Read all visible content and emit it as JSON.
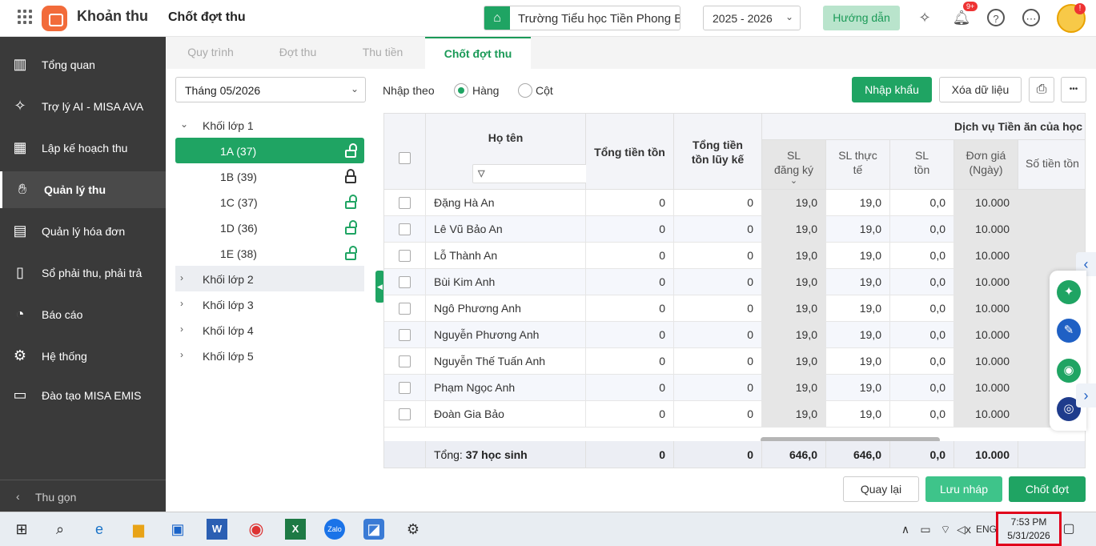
{
  "header": {
    "app_title": "Khoản thu",
    "page_title": "Chốt đợt thu",
    "school": "Trường Tiểu học Tiền Phong B",
    "year": "2025 - 2026",
    "guide_label": "Hướng dẫn",
    "notification_count": "9+",
    "avatar_badge": "!"
  },
  "sidebar": {
    "items": [
      {
        "label": "Tổng quan",
        "icon": "chart-icon"
      },
      {
        "label": "Trợ lý AI - MISA AVA",
        "icon": "sparkle-icon"
      },
      {
        "label": "Lập kế hoạch thu",
        "icon": "calendar-icon"
      },
      {
        "label": "Quản lý thu",
        "icon": "hand-coin-icon"
      },
      {
        "label": "Quản lý hóa đơn",
        "icon": "invoice-icon"
      },
      {
        "label": "Sổ phải thu, phải trả",
        "icon": "book-icon"
      },
      {
        "label": "Báo cáo",
        "icon": "pie-icon"
      },
      {
        "label": "Hệ thống",
        "icon": "gear-icon"
      },
      {
        "label": "Đào tạo MISA EMIS",
        "icon": "open-book-icon"
      }
    ],
    "collapse_label": "Thu gọn"
  },
  "tabs": [
    "Quy trình",
    "Đợt thu",
    "Thu tiền",
    "Chốt đợt thu"
  ],
  "filter": {
    "month": "Tháng 05/2026",
    "nhap_theo": "Nhập theo",
    "radio_row": "Hàng",
    "radio_col": "Cột"
  },
  "tree": {
    "group1": "Khối lớp 1",
    "classes": [
      "1A (37)",
      "1B (39)",
      "1C (37)",
      "1D (36)",
      "1E (38)"
    ],
    "groups": [
      "Khối lớp 2",
      "Khối lớp 3",
      "Khối lớp 4",
      "Khối lớp 5"
    ]
  },
  "toolbar": {
    "import": "Nhập khẩu",
    "clear": "Xóa dữ liệu",
    "more": "•••"
  },
  "table": {
    "col_name": "Họ tên",
    "col_total": "Tổng tiền tồn",
    "col_cum": "Tổng tiền tồn lũy kế",
    "group_header": "Dịch vụ Tiền ăn của học sinh",
    "sub_headers": [
      "SL đăng ký",
      "SL thực tế",
      "SL tồn",
      "Đơn giá (Ngày)",
      "Số tiền tồn"
    ],
    "rows": [
      {
        "name": "Đặng Hà An",
        "total": "0",
        "cum": "0",
        "reg": "19,0",
        "act": "19,0",
        "rem": "0,0",
        "price": "10.000"
      },
      {
        "name": "Lê Vũ Bảo An",
        "total": "0",
        "cum": "0",
        "reg": "19,0",
        "act": "19,0",
        "rem": "0,0",
        "price": "10.000"
      },
      {
        "name": "Lỗ Thành An",
        "total": "0",
        "cum": "0",
        "reg": "19,0",
        "act": "19,0",
        "rem": "0,0",
        "price": "10.000"
      },
      {
        "name": "Bùi Kim Anh",
        "total": "0",
        "cum": "0",
        "reg": "19,0",
        "act": "19,0",
        "rem": "0,0",
        "price": "10.000"
      },
      {
        "name": "Ngô Phương Anh",
        "total": "0",
        "cum": "0",
        "reg": "19,0",
        "act": "19,0",
        "rem": "0,0",
        "price": "10.000"
      },
      {
        "name": "Nguyễn Phương Anh",
        "total": "0",
        "cum": "0",
        "reg": "19,0",
        "act": "19,0",
        "rem": "0,0",
        "price": "10.000"
      },
      {
        "name": "Nguyễn Thế Tuấn Anh",
        "total": "0",
        "cum": "0",
        "reg": "19,0",
        "act": "19,0",
        "rem": "0,0",
        "price": "10.000"
      },
      {
        "name": "Phạm Ngọc Anh",
        "total": "0",
        "cum": "0",
        "reg": "19,0",
        "act": "19,0",
        "rem": "0,0",
        "price": "10.000"
      },
      {
        "name": "Đoàn Gia Bảo",
        "total": "0",
        "cum": "0",
        "reg": "19,0",
        "act": "19,0",
        "rem": "0,0",
        "price": "10.000"
      }
    ],
    "footer": {
      "label": "Tổng:",
      "count": "37 học sinh",
      "total": "0",
      "cum": "0",
      "reg": "646,0",
      "act": "646,0",
      "rem": "0,0",
      "price": "10.000"
    }
  },
  "actions": {
    "back": "Quay lại",
    "draft": "Lưu nháp",
    "close": "Chốt đợt"
  },
  "taskbar": {
    "lang": "ENG",
    "time": "7:53 PM",
    "date": "5/31/2026"
  },
  "colors": {
    "brand_green": "#1fa463",
    "sidebar": "#3a3a3a",
    "logo_orange": "#f26b3a"
  }
}
